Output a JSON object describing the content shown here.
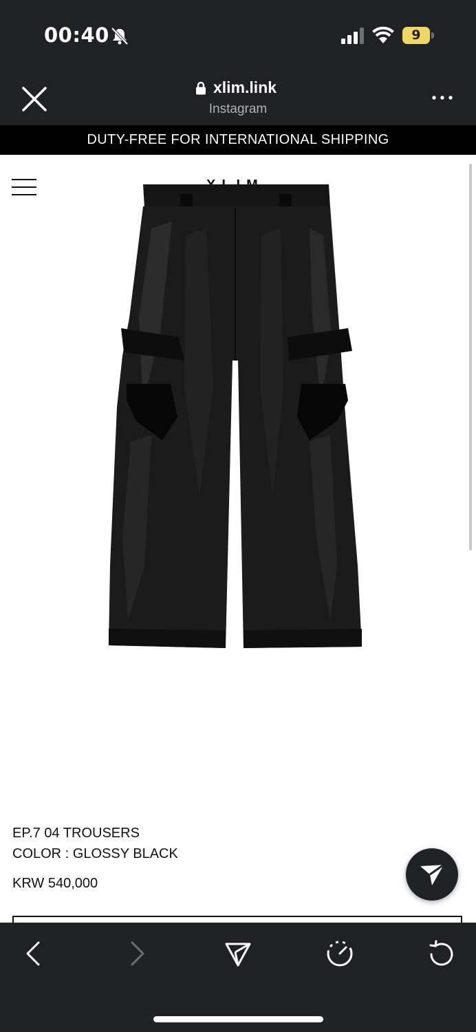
{
  "status_bar": {
    "time": "00:40",
    "battery_level": "9",
    "icons": [
      "bell-slash-icon",
      "signal-icon",
      "wifi-icon",
      "battery-icon"
    ]
  },
  "browser": {
    "domain": "xlim.link",
    "source": "Instagram",
    "icons": [
      "close-icon",
      "lock-icon",
      "more-icon"
    ]
  },
  "page": {
    "announcement": "DUTY-FREE FOR INTERNATIONAL SHIPPING",
    "logo": "XLIM",
    "product": {
      "title": "EP.7 04 TROUSERS",
      "color": "COLOR : GLOSSY BLACK",
      "price": "KRW 540,000"
    }
  },
  "toolbar": {
    "icons": [
      "back-icon",
      "forward-icon",
      "share-icon",
      "speed-icon",
      "reload-icon"
    ]
  },
  "colors": {
    "chrome": "#1f2125",
    "battery": "#f0d760",
    "announcement_bg": "#000000"
  }
}
